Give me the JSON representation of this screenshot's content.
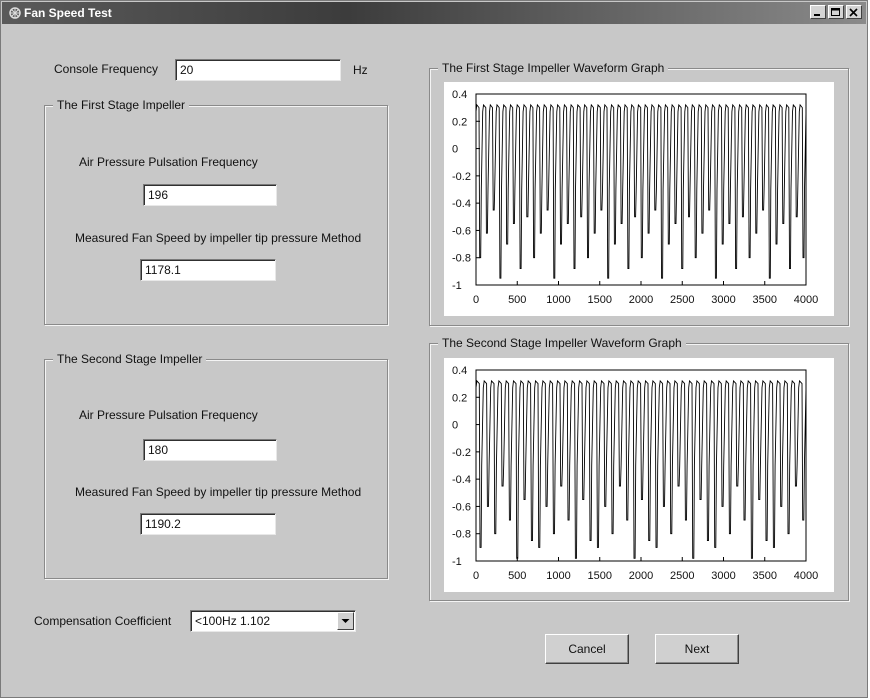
{
  "window": {
    "title": "Fan Speed Test"
  },
  "console": {
    "label": "Console Frequency",
    "value": "20",
    "unit": "Hz"
  },
  "stage1": {
    "title": "The First Stage Impeller",
    "pressure_label": "Air Pressure Pulsation Frequency",
    "pressure_value": "196",
    "speed_label": "Measured Fan Speed by impeller tip pressure Method",
    "speed_value": "1178.1"
  },
  "stage2": {
    "title": "The Second Stage Impeller",
    "pressure_label": "Air Pressure Pulsation Frequency",
    "pressure_value": "180",
    "speed_label": "Measured Fan Speed by impeller tip pressure Method",
    "speed_value": "1190.2"
  },
  "compensation": {
    "label": "Compensation Coefficient",
    "selected": "<100Hz 1.102"
  },
  "buttons": {
    "cancel": "Cancel",
    "next": "Next"
  },
  "chart_data": [
    {
      "type": "line",
      "title": "The First Stage Impeller  Waveform Graph",
      "xlim": [
        0,
        4000
      ],
      "ylim": [
        -1,
        0.4
      ],
      "x_ticks": [
        "0",
        "500",
        "1000",
        "1500",
        "2000",
        "2500",
        "3000",
        "3500",
        "4000"
      ],
      "y_ticks": [
        "0.4",
        "0.2",
        "0",
        "-0.2",
        "-0.4",
        "-0.6",
        "-0.8",
        "-1"
      ],
      "cycles": 49,
      "peak": 0.32,
      "troughs": [
        -0.8,
        -0.62,
        -0.45,
        -0.95,
        -0.7,
        -0.55,
        -0.88,
        -0.5
      ]
    },
    {
      "type": "line",
      "title": "The Second Stage Impeller   Waveform Graph",
      "xlim": [
        0,
        4000
      ],
      "ylim": [
        -1,
        0.4
      ],
      "x_ticks": [
        "0",
        "500",
        "1000",
        "1500",
        "2000",
        "2500",
        "3000",
        "3500",
        "4000"
      ],
      "y_ticks": [
        "0.4",
        "0.2",
        "0",
        "-0.2",
        "-0.4",
        "-0.6",
        "-0.8",
        "-1"
      ],
      "cycles": 45,
      "peak": 0.32,
      "troughs": [
        -0.9,
        -0.6,
        -0.8,
        -0.45,
        -0.7,
        -0.98,
        -0.55,
        -0.85
      ]
    }
  ]
}
